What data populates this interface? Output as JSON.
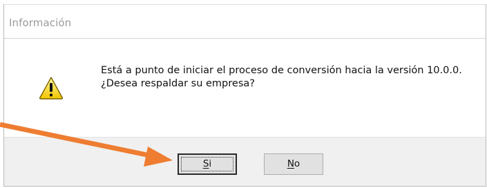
{
  "dialog": {
    "title": "Información",
    "message_line1": "Está a punto de iniciar el proceso de conversión hacia la versión 10.0.0.",
    "message_line2": "¿Desea respaldar su empresa?",
    "icon": "warning-icon"
  },
  "buttons": {
    "yes": {
      "mnemonic": "S",
      "rest": "i"
    },
    "no": {
      "mnemonic": "N",
      "rest": "o"
    }
  },
  "annotation": {
    "arrow_color": "#ee7d31"
  }
}
